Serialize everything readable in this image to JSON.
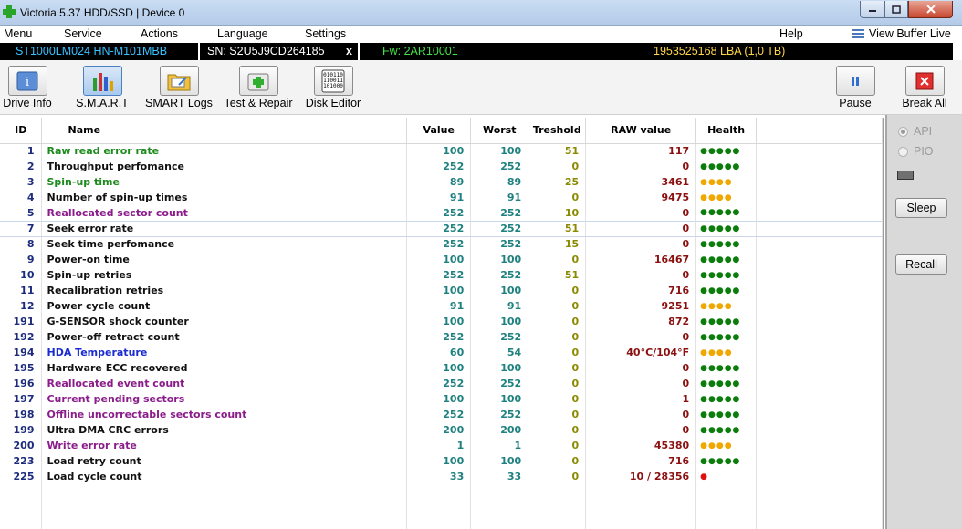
{
  "window": {
    "title": "Victoria 5.37 HDD/SSD | Device 0",
    "app_icon": "green-cross-icon",
    "controls": {
      "minimize": "minimize-icon",
      "maximize": "maximize-icon",
      "close": "close-icon"
    }
  },
  "menu": {
    "items": [
      "Menu",
      "Service",
      "Actions",
      "Language",
      "Settings"
    ],
    "help": "Help",
    "view_buffer": "View Buffer Live"
  },
  "device": {
    "model": "ST1000LM024 HN-M101MBB",
    "serial": "SN: S2U5J9CD264185",
    "close": "x",
    "firmware": "Fw: 2AR10001",
    "capacity": "1953525168 LBA (1,0 TB)",
    "colors": {
      "model": "#38c0ff",
      "serial": "#ffffff",
      "firmware": "#45e04a",
      "capacity": "#ffd54a"
    }
  },
  "toolbar": {
    "tools": [
      {
        "label": "Drive Info",
        "icon": "drive-info-icon"
      },
      {
        "label": "S.M.A.R.T",
        "icon": "smart-chart-icon",
        "active": true
      },
      {
        "label": "SMART Logs",
        "icon": "smart-logs-icon"
      },
      {
        "label": "Test & Repair",
        "icon": "test-repair-icon"
      },
      {
        "label": "Disk Editor",
        "icon": "disk-editor-icon"
      }
    ],
    "pause": {
      "label": "Pause",
      "icon": "pause-icon"
    },
    "break_all": {
      "label": "Break All",
      "icon": "break-all-icon"
    }
  },
  "smart_table": {
    "headers": [
      "ID",
      "Name",
      "Value",
      "Worst",
      "Treshold",
      "RAW value",
      "Health"
    ],
    "rows": [
      {
        "id": "1",
        "name": "Raw read error rate",
        "value": "100",
        "worst": "100",
        "threshold": "51",
        "raw": "117",
        "health": "●●●●●",
        "name_color": "green",
        "raw_color": "",
        "health_color": "green"
      },
      {
        "id": "2",
        "name": "Throughput perfomance",
        "value": "252",
        "worst": "252",
        "threshold": "0",
        "raw": "0",
        "health": "●●●●●",
        "name_color": "black",
        "raw_color": "",
        "health_color": "green"
      },
      {
        "id": "3",
        "name": "Spin-up time",
        "value": "89",
        "worst": "89",
        "threshold": "25",
        "raw": "3461",
        "health": "●●●●",
        "name_color": "green",
        "raw_color": "",
        "health_color": "yellow"
      },
      {
        "id": "4",
        "name": "Number of spin-up times",
        "value": "91",
        "worst": "91",
        "threshold": "0",
        "raw": "9475",
        "health": "●●●●",
        "name_color": "black",
        "raw_color": "",
        "health_color": "yellow"
      },
      {
        "id": "5",
        "name": "Reallocated sector count",
        "value": "252",
        "worst": "252",
        "threshold": "10",
        "raw": "0",
        "health": "●●●●●",
        "name_color": "purple",
        "raw_color": "green",
        "health_color": "green"
      },
      {
        "id": "7",
        "name": "Seek error rate",
        "value": "252",
        "worst": "252",
        "threshold": "51",
        "raw": "0",
        "health": "●●●●●",
        "name_color": "black",
        "raw_color": "",
        "health_color": "green",
        "selected": true
      },
      {
        "id": "8",
        "name": "Seek time perfomance",
        "value": "252",
        "worst": "252",
        "threshold": "15",
        "raw": "0",
        "health": "●●●●●",
        "name_color": "black",
        "raw_color": "",
        "health_color": "green"
      },
      {
        "id": "9",
        "name": "Power-on time",
        "value": "100",
        "worst": "100",
        "threshold": "0",
        "raw": "16467",
        "health": "●●●●●",
        "name_color": "black",
        "raw_color": "",
        "health_color": "green"
      },
      {
        "id": "10",
        "name": "Spin-up retries",
        "value": "252",
        "worst": "252",
        "threshold": "51",
        "raw": "0",
        "health": "●●●●●",
        "name_color": "black",
        "raw_color": "",
        "health_color": "green"
      },
      {
        "id": "11",
        "name": "Recalibration retries",
        "value": "100",
        "worst": "100",
        "threshold": "0",
        "raw": "716",
        "health": "●●●●●",
        "name_color": "black",
        "raw_color": "",
        "health_color": "green"
      },
      {
        "id": "12",
        "name": "Power cycle count",
        "value": "91",
        "worst": "91",
        "threshold": "0",
        "raw": "9251",
        "health": "●●●●",
        "name_color": "black",
        "raw_color": "",
        "health_color": "yellow"
      },
      {
        "id": "191",
        "name": "G-SENSOR shock counter",
        "value": "100",
        "worst": "100",
        "threshold": "0",
        "raw": "872",
        "health": "●●●●●",
        "name_color": "black",
        "raw_color": "red",
        "health_color": "green"
      },
      {
        "id": "192",
        "name": "Power-off retract count",
        "value": "252",
        "worst": "252",
        "threshold": "0",
        "raw": "0",
        "health": "●●●●●",
        "name_color": "black",
        "raw_color": "",
        "health_color": "green"
      },
      {
        "id": "194",
        "name": "HDA Temperature",
        "value": "60",
        "worst": "54",
        "threshold": "0",
        "raw": "40°C/104°F",
        "health": "●●●●",
        "name_color": "blue",
        "raw_color": "blue",
        "health_color": "yellow"
      },
      {
        "id": "195",
        "name": "Hardware ECC recovered",
        "value": "100",
        "worst": "100",
        "threshold": "0",
        "raw": "0",
        "health": "●●●●●",
        "name_color": "black",
        "raw_color": "",
        "health_color": "green"
      },
      {
        "id": "196",
        "name": "Reallocated event count",
        "value": "252",
        "worst": "252",
        "threshold": "0",
        "raw": "0",
        "health": "●●●●●",
        "name_color": "purple",
        "raw_color": "green",
        "health_color": "green"
      },
      {
        "id": "197",
        "name": "Current pending sectors",
        "value": "100",
        "worst": "100",
        "threshold": "0",
        "raw": "1",
        "health": "●●●●●",
        "name_color": "purple",
        "raw_color": "red",
        "health_color": "green"
      },
      {
        "id": "198",
        "name": "Offline uncorrectable sectors count",
        "value": "252",
        "worst": "252",
        "threshold": "0",
        "raw": "0",
        "health": "●●●●●",
        "name_color": "purple",
        "raw_color": "green",
        "health_color": "green"
      },
      {
        "id": "199",
        "name": "Ultra DMA CRC errors",
        "value": "200",
        "worst": "200",
        "threshold": "0",
        "raw": "0",
        "health": "●●●●●",
        "name_color": "black",
        "raw_color": "",
        "health_color": "green"
      },
      {
        "id": "200",
        "name": "Write error rate",
        "value": "1",
        "worst": "1",
        "threshold": "0",
        "raw": "45380",
        "health": "●●●●",
        "name_color": "purple",
        "raw_color": "red",
        "health_color": "yellow"
      },
      {
        "id": "223",
        "name": "Load retry count",
        "value": "100",
        "worst": "100",
        "threshold": "0",
        "raw": "716",
        "health": "●●●●●",
        "name_color": "black",
        "raw_color": "",
        "health_color": "green"
      },
      {
        "id": "225",
        "name": "Load cycle count",
        "value": "33",
        "worst": "33",
        "threshold": "0",
        "raw": "10 / 28356",
        "health": "●",
        "name_color": "black",
        "raw_color": "",
        "health_color": "red"
      }
    ]
  },
  "side_panel": {
    "api_label": "API",
    "pio_label": "PIO",
    "api_selected": true,
    "sleep": "Sleep",
    "recall": "Recall"
  }
}
